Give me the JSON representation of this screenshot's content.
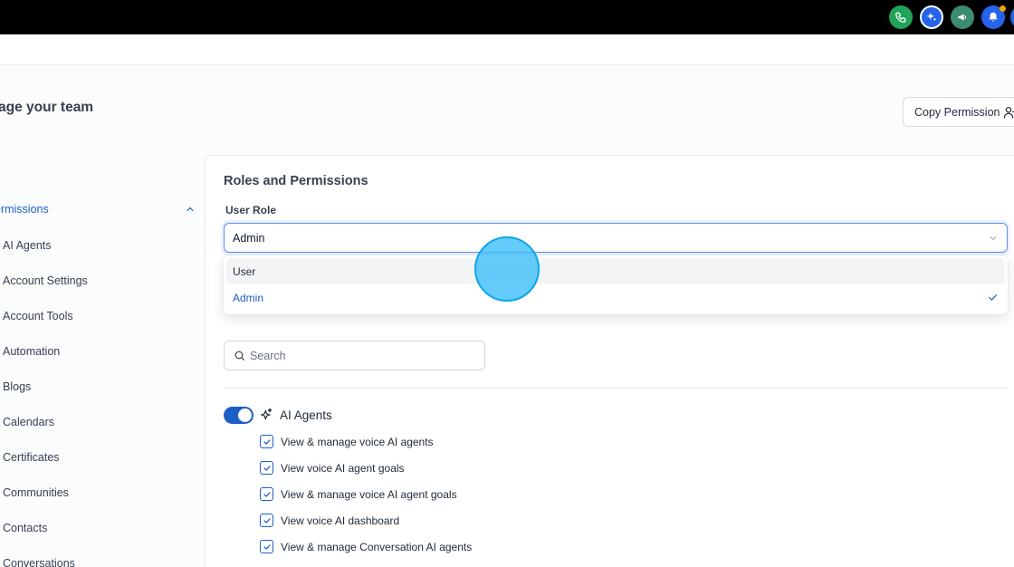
{
  "header": {
    "icons": [
      {
        "name": "phone-icon",
        "color": "#22a35a"
      },
      {
        "name": "ai-sparkle-icon",
        "color": "#2563eb"
      },
      {
        "name": "megaphone-icon",
        "color": "#3b8c72"
      },
      {
        "name": "bell-icon",
        "color": "#2563eb"
      }
    ]
  },
  "page": {
    "title": "age your team",
    "copy_button_label": "Copy Permission"
  },
  "sidebar": {
    "section_label": "ermissions",
    "items": [
      "AI Agents",
      "Account Settings",
      "Account Tools",
      "Automation",
      "Blogs",
      "Calendars",
      "Certificates",
      "Communities",
      "Contacts",
      "Conversations"
    ]
  },
  "panel": {
    "title": "Roles and Permissions",
    "role_label": "User Role",
    "role_value": "Admin",
    "role_options": [
      "User",
      "Admin"
    ],
    "selected_option": "Admin",
    "search_placeholder": "Search",
    "group": {
      "label": "AI Agents",
      "enabled": true,
      "permissions": [
        "View & manage voice AI agents",
        "View voice AI agent goals",
        "View & manage voice AI agent goals",
        "View voice AI dashboard",
        "View & manage Conversation AI agents"
      ]
    }
  },
  "colors": {
    "accent": "#1d5fc7",
    "focus_border": "#5b8ff0",
    "cursor_highlight": "#38bdf8"
  }
}
